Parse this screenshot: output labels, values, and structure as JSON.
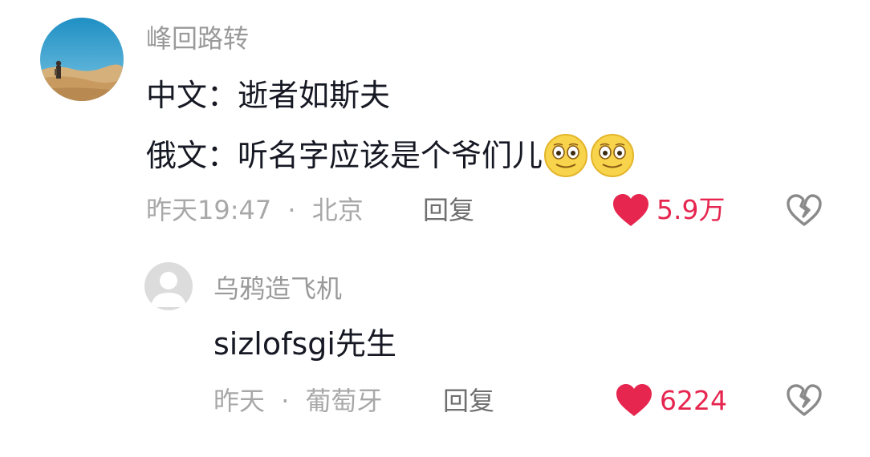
{
  "comments": [
    {
      "username": "峰回路转",
      "lines": [
        "中文：逝者如斯夫",
        "俄文：听名字应该是个爷们儿"
      ],
      "emojis": [
        "smile-emoji",
        "smile-emoji"
      ],
      "time": "昨天19:47",
      "separator": "·",
      "location": "北京",
      "reply_label": "回复",
      "likes": "5.9万",
      "liked": true
    },
    {
      "username": "乌鸦造飞机",
      "lines": [
        "sizlofsgi先生"
      ],
      "time": "昨天",
      "separator": "·",
      "location": "葡萄牙",
      "reply_label": "回复",
      "likes": "6224",
      "liked": true
    }
  ],
  "colors": {
    "like_red": "#e6264f",
    "username_grey": "#9a9a9a",
    "text": "#161823"
  },
  "icons": [
    "heart-filled-icon",
    "broken-heart-icon",
    "default-avatar-icon"
  ]
}
